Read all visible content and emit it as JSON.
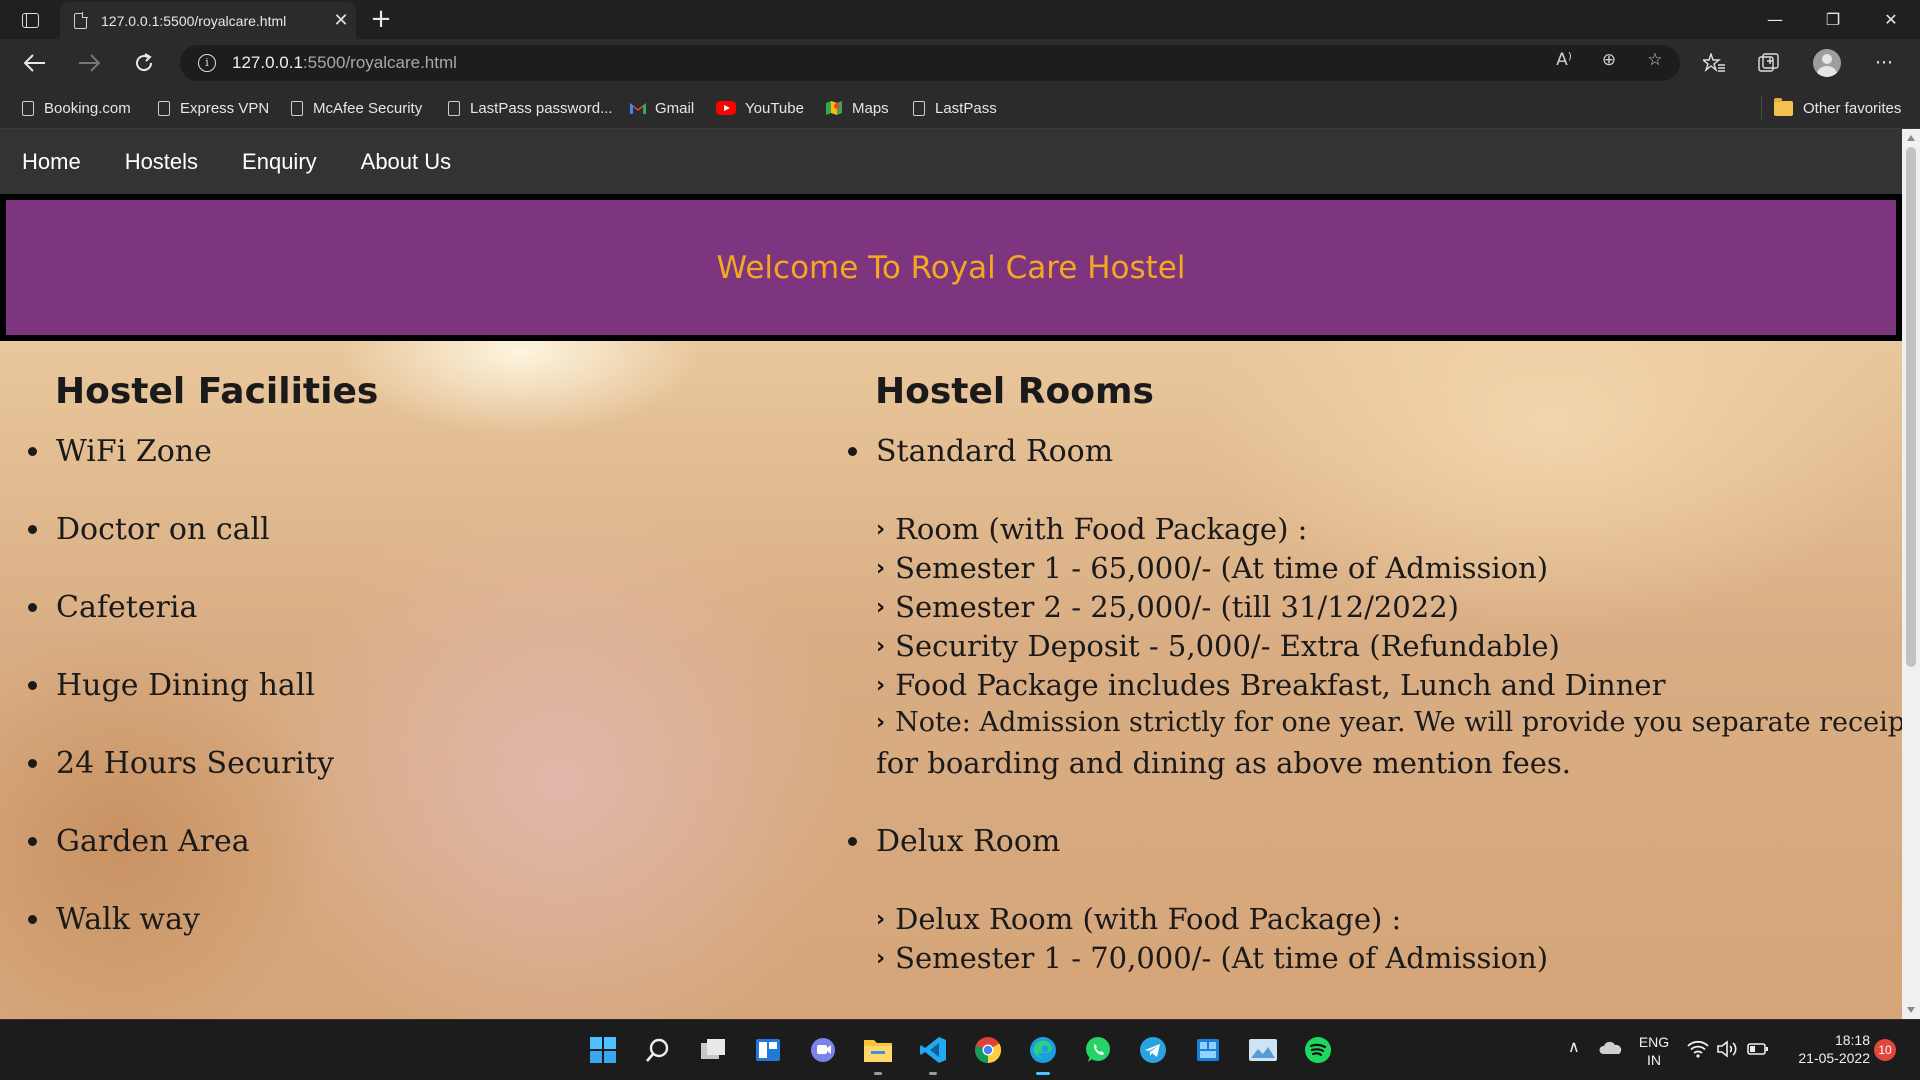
{
  "browser": {
    "tab_title": "127.0.0.1:5500/royalcare.html",
    "tab_close": "✕",
    "new_tab": "+",
    "window_controls": {
      "minimize": "—",
      "restore": "❐",
      "close": "✕"
    },
    "address_host": "127.0.0.1",
    "address_path": ":5500/royalcare.html",
    "read_aloud": "A⁾",
    "zoom": "⊕",
    "favorites_add": "☆",
    "more": "···",
    "favorites": [
      {
        "label": "Booking.com",
        "icon": "page-icon"
      },
      {
        "label": "Express VPN",
        "icon": "page-icon"
      },
      {
        "label": "McAfee Security",
        "icon": "page-icon"
      },
      {
        "label": "LastPass password...",
        "icon": "page-icon"
      },
      {
        "label": "Gmail",
        "icon": "gmail-icon"
      },
      {
        "label": "YouTube",
        "icon": "youtube-icon"
      },
      {
        "label": "Maps",
        "icon": "maps-icon"
      },
      {
        "label": "LastPass",
        "icon": "page-icon"
      }
    ],
    "other_favorites": "Other favorites"
  },
  "site": {
    "nav": [
      "Home",
      "Hostels",
      "Enquiry",
      "About Us"
    ],
    "banner_title": "Welcome To Royal Care Hostel",
    "colors": {
      "banner_bg": "#7d3580",
      "banner_text": "#f5a81e",
      "nav_bg": "#333333"
    },
    "facilities": {
      "heading": "Hostel Facilities",
      "items": [
        "WiFi Zone",
        "Doctor on call",
        "Cafeteria",
        "Huge Dining hall",
        "24 Hours Security",
        "Garden Area",
        "Walk way"
      ]
    },
    "rooms": {
      "heading": "Hostel Rooms",
      "standard": {
        "title": "Standard Room",
        "details": [
          "Room (with Food Package) :",
          "Semester 1 - 65,000/- (At time of Admission)",
          "Semester 2 - 25,000/- (till 31/12/2022)",
          "Security Deposit - 5,000/- Extra (Refundable)",
          "Food Package includes Breakfast, Lunch and Dinner",
          "Note: Admission strictly for one year. We will provide you separate receipt"
        ],
        "note_continued": "for boarding and dining as above mention fees."
      },
      "delux": {
        "title": "Delux Room",
        "details": [
          "Delux Room (with Food Package) :",
          "Semester 1 - 70,000/- (At time of Admission)"
        ]
      }
    }
  },
  "taskbar": {
    "language": "ENG",
    "region": "IN",
    "time": "18:18",
    "date": "21-05-2022",
    "notifications": "10"
  }
}
